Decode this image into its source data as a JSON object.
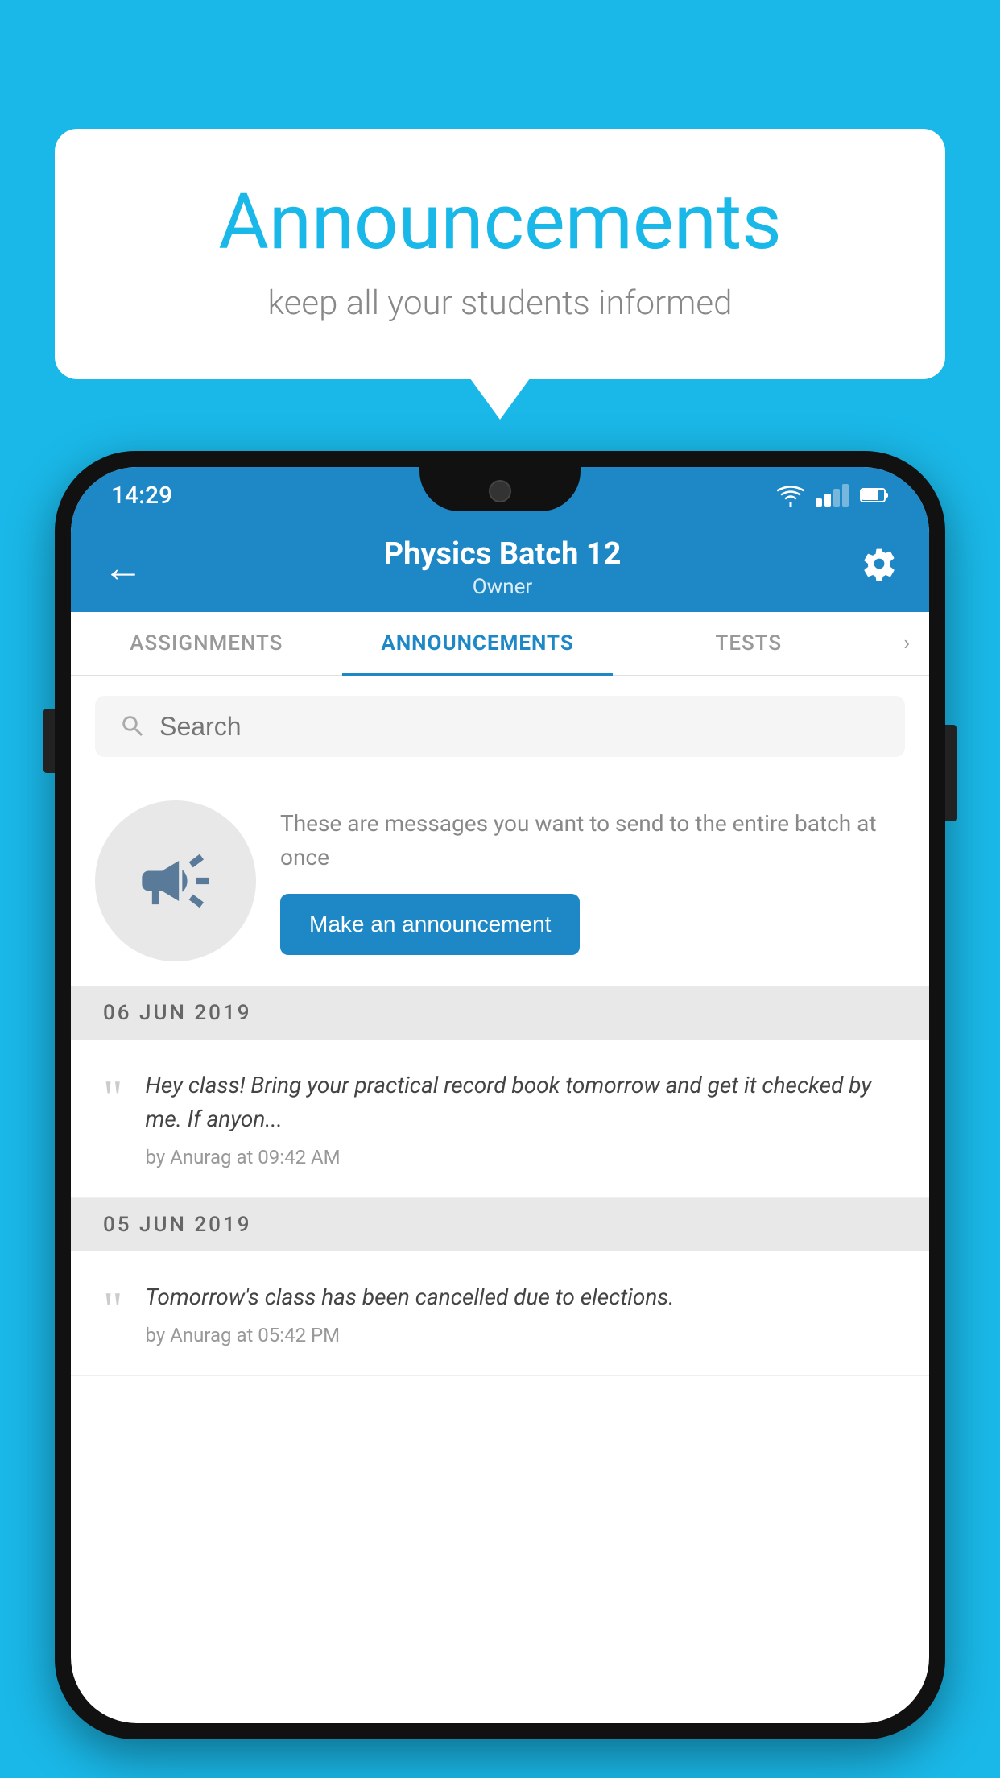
{
  "bubble": {
    "title": "Announcements",
    "subtitle": "keep all your students informed"
  },
  "status_bar": {
    "time": "14:29",
    "wifi": "▲",
    "battery": "▮"
  },
  "header": {
    "title": "Physics Batch 12",
    "subtitle": "Owner",
    "back_label": "←",
    "gear_label": "⚙"
  },
  "tabs": [
    {
      "label": "ASSIGNMENTS",
      "active": false
    },
    {
      "label": "ANNOUNCEMENTS",
      "active": true
    },
    {
      "label": "TESTS",
      "active": false
    },
    {
      "label": "›",
      "active": false
    }
  ],
  "search": {
    "placeholder": "Search"
  },
  "promo": {
    "description": "These are messages you want to send to the entire batch at once",
    "button_label": "Make an announcement"
  },
  "date_groups": [
    {
      "date": "06  JUN  2019",
      "announcements": [
        {
          "message": "Hey class! Bring your practical record book tomorrow and get it checked by me. If anyon...",
          "meta": "by Anurag at 09:42 AM"
        }
      ]
    },
    {
      "date": "05  JUN  2019",
      "announcements": [
        {
          "message": "Tomorrow's class has been cancelled due to elections.",
          "meta": "by Anurag at 05:42 PM"
        }
      ]
    }
  ]
}
